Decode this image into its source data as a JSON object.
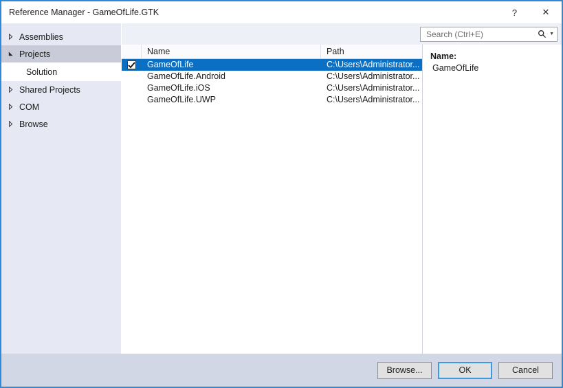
{
  "window": {
    "title": "Reference Manager - GameOfLife.GTK",
    "help_label": "?",
    "close_label": "✕",
    "accent_color": "#2e8ad8",
    "selection_color": "#0b6fc4",
    "sidebar_color": "#e6e9f4",
    "footer_color": "#d2d7e6"
  },
  "sidebar": {
    "items": [
      {
        "label": "Assemblies",
        "state": "collapsed",
        "selected": false,
        "child": false
      },
      {
        "label": "Projects",
        "state": "expanded",
        "selected": true,
        "child": false
      },
      {
        "label": "Solution",
        "state": "leaf",
        "selected": false,
        "child": true
      },
      {
        "label": "Shared Projects",
        "state": "collapsed",
        "selected": false,
        "child": false
      },
      {
        "label": "COM",
        "state": "collapsed",
        "selected": false,
        "child": false
      },
      {
        "label": "Browse",
        "state": "collapsed",
        "selected": false,
        "child": false
      }
    ]
  },
  "search": {
    "value": "",
    "placeholder": "Search (Ctrl+E)",
    "icon": "search-icon",
    "dropdown_icon": "chevron-down-icon"
  },
  "list": {
    "columns": [
      {
        "key": "check",
        "label": ""
      },
      {
        "key": "name",
        "label": "Name"
      },
      {
        "key": "path",
        "label": "Path"
      }
    ],
    "rows": [
      {
        "checked": true,
        "selected": true,
        "name": "GameOfLife",
        "path": "C:\\Users\\Administrator..."
      },
      {
        "checked": false,
        "selected": false,
        "name": "GameOfLife.Android",
        "path": "C:\\Users\\Administrator..."
      },
      {
        "checked": false,
        "selected": false,
        "name": "GameOfLife.iOS",
        "path": "C:\\Users\\Administrator..."
      },
      {
        "checked": false,
        "selected": false,
        "name": "GameOfLife.UWP",
        "path": "C:\\Users\\Administrator..."
      }
    ]
  },
  "detail": {
    "label": "Name:",
    "value": "GameOfLife"
  },
  "footer": {
    "browse_label": "Browse...",
    "ok_label": "OK",
    "cancel_label": "Cancel"
  }
}
